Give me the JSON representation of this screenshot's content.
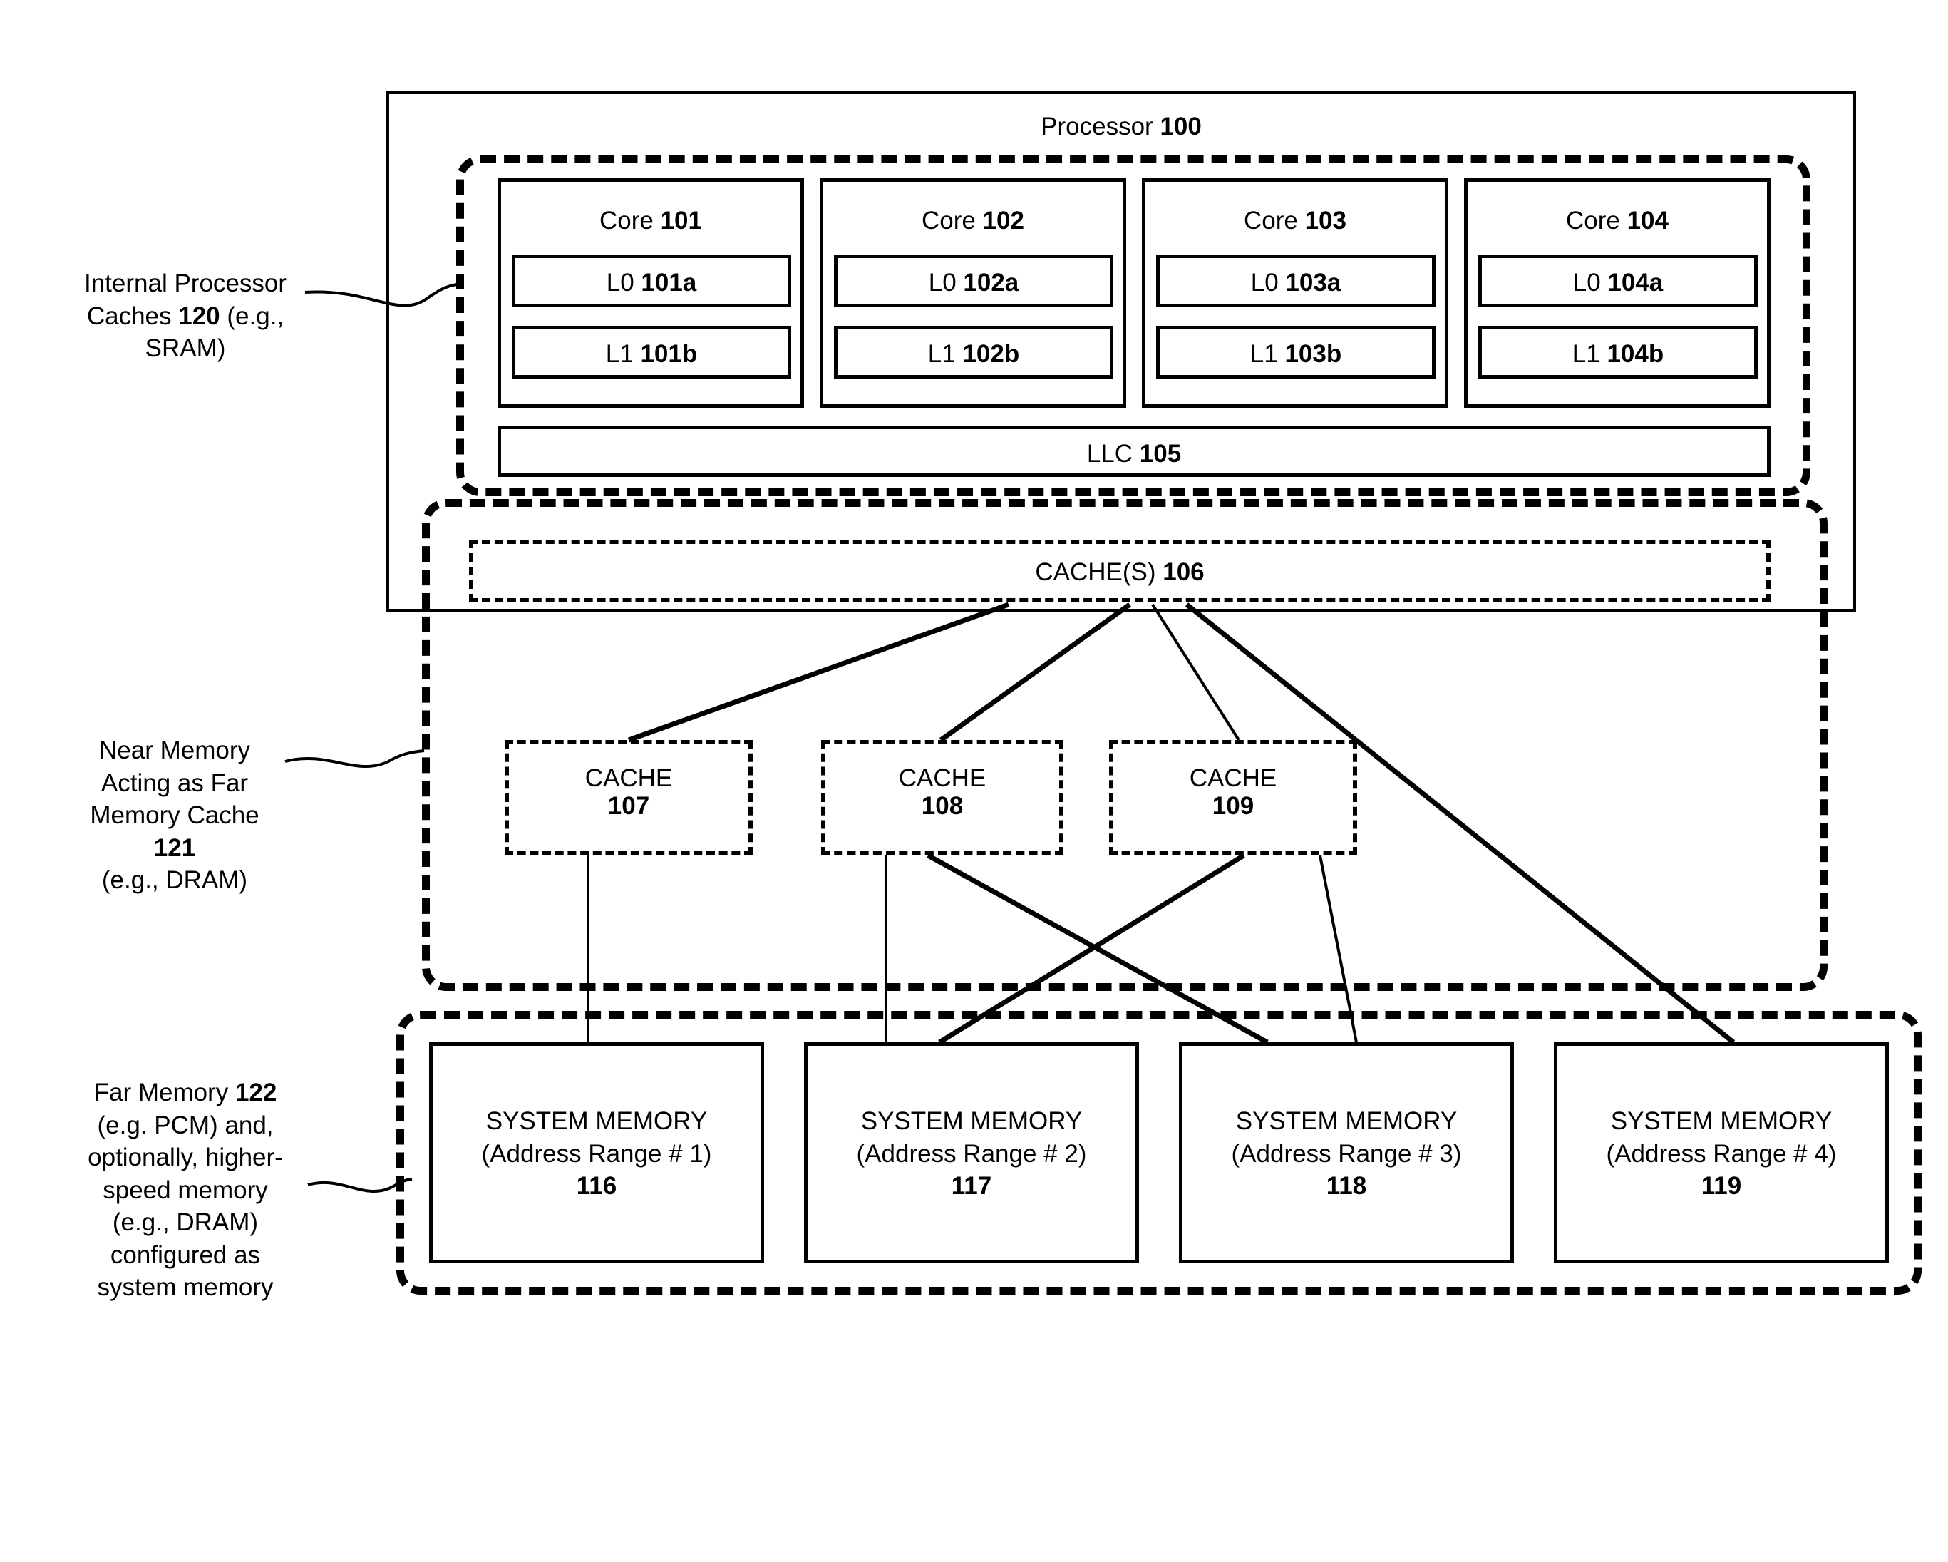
{
  "figure": {
    "processor": {
      "title_text": "Processor ",
      "title_num": "100"
    },
    "cores": [
      {
        "name": "Core ",
        "num": "101",
        "l0": "L0 ",
        "l0_num": "101a",
        "l1": "L1 ",
        "l1_num": "101b"
      },
      {
        "name": "Core ",
        "num": "102",
        "l0": "L0 ",
        "l0_num": "102a",
        "l1": "L1 ",
        "l1_num": "102b"
      },
      {
        "name": "Core ",
        "num": "103",
        "l0": "L0 ",
        "l0_num": "103a",
        "l1": "L1 ",
        "l1_num": "103b"
      },
      {
        "name": "Core ",
        "num": "104",
        "l0": "L0 ",
        "l0_num": "104a",
        "l1": "L1 ",
        "l1_num": "104b"
      }
    ],
    "llc": {
      "label": "LLC ",
      "num": "105"
    },
    "cache_s": {
      "label": "CACHE(S) ",
      "num": "106"
    },
    "near_caches": [
      {
        "label": "CACHE",
        "num": "107"
      },
      {
        "label": "CACHE",
        "num": "108"
      },
      {
        "label": "CACHE",
        "num": "109"
      }
    ],
    "system_memories": [
      {
        "line1": "SYSTEM MEMORY",
        "line2": "(Address Range # 1)",
        "num": "116"
      },
      {
        "line1": "SYSTEM MEMORY",
        "line2": "(Address Range # 2)",
        "num": "117"
      },
      {
        "line1": "SYSTEM MEMORY",
        "line2": "(Address Range # 3)",
        "num": "118"
      },
      {
        "line1": "SYSTEM MEMORY",
        "line2": "(Address Range # 4)",
        "num": "119"
      }
    ],
    "annotations": {
      "internal_caches": {
        "l1": "Internal Processor",
        "l2_a": "Caches ",
        "l2_num": "120",
        "l2_b": " (e.g.,",
        "l3": "SRAM)"
      },
      "near_memory": {
        "l1": "Near Memory",
        "l2": "Acting as Far",
        "l3": "Memory Cache",
        "l4_num": "121",
        "l5": "(e.g., DRAM)"
      },
      "far_memory": {
        "l1_a": "Far Memory ",
        "l1_num": "122",
        "l2": "(e.g. PCM) and,",
        "l3": "optionally, higher-",
        "l4": "speed memory",
        "l5": "(e.g., DRAM)",
        "l6": "configured as",
        "l7": "system memory"
      }
    },
    "colors": {
      "ink": "#000000",
      "paper": "#ffffff"
    }
  }
}
